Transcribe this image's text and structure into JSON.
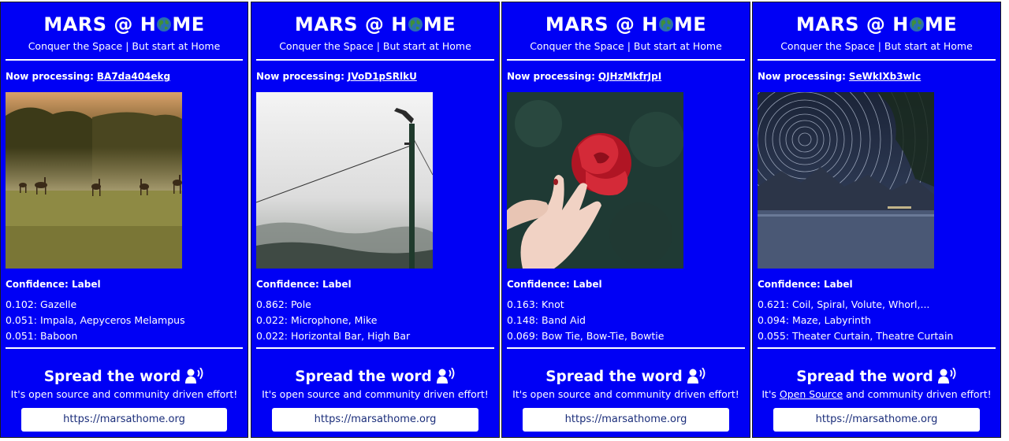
{
  "header": {
    "title_left": "MARS @ H",
    "title_right": "ME",
    "subtitle": "Conquer the Space | But start at Home"
  },
  "labels": {
    "now_processing": "Now processing:",
    "confidence_header": "Confidence: Label"
  },
  "footer": {
    "spread_title": "Spread the word",
    "tagline": "It's open source and community driven effort!",
    "tagline_parts": [
      "It's ",
      "Open Source",
      " and community driven effort!"
    ],
    "url": "https://marsathome.org"
  },
  "icons": {
    "globe": "globe-icon",
    "speaker": "speaking-person-icon"
  },
  "colors": {
    "panel_bg": "#0000f5",
    "text": "#ffffff",
    "button_bg": "#ffffff",
    "button_text": "#1a2d7a"
  },
  "panels": [
    {
      "image_id": "BA7da404ekg",
      "photo": "deer-in-foggy-field",
      "predictions": [
        {
          "text": "0.102: Gazelle"
        },
        {
          "text": "0.051: Impala, Aepyceros Melampus"
        },
        {
          "text": "0.051: Baboon"
        }
      ]
    },
    {
      "image_id": "JVoD1pSRlkU",
      "photo": "utility-pole-in-fog",
      "predictions": [
        {
          "text": "0.862: Pole"
        },
        {
          "text": "0.022: Microphone, Mike"
        },
        {
          "text": "0.022: Horizontal Bar, High Bar"
        }
      ]
    },
    {
      "image_id": "QJHzMkfrJpI",
      "photo": "hand-holding-red-rose",
      "predictions": [
        {
          "text": "0.163: Knot"
        },
        {
          "text": "0.148: Band Aid"
        },
        {
          "text": "0.069: Bow Tie, Bow-Tie, Bowtie"
        }
      ]
    },
    {
      "image_id": "SeWkIXb3wIc",
      "photo": "star-trails-over-mountains",
      "predictions": [
        {
          "text": "0.621: Coil, Spiral, Volute, Whorl,..."
        },
        {
          "text": "0.094: Maze, Labyrinth"
        },
        {
          "text": "0.055: Theater Curtain, Theatre Curtain"
        }
      ]
    }
  ]
}
